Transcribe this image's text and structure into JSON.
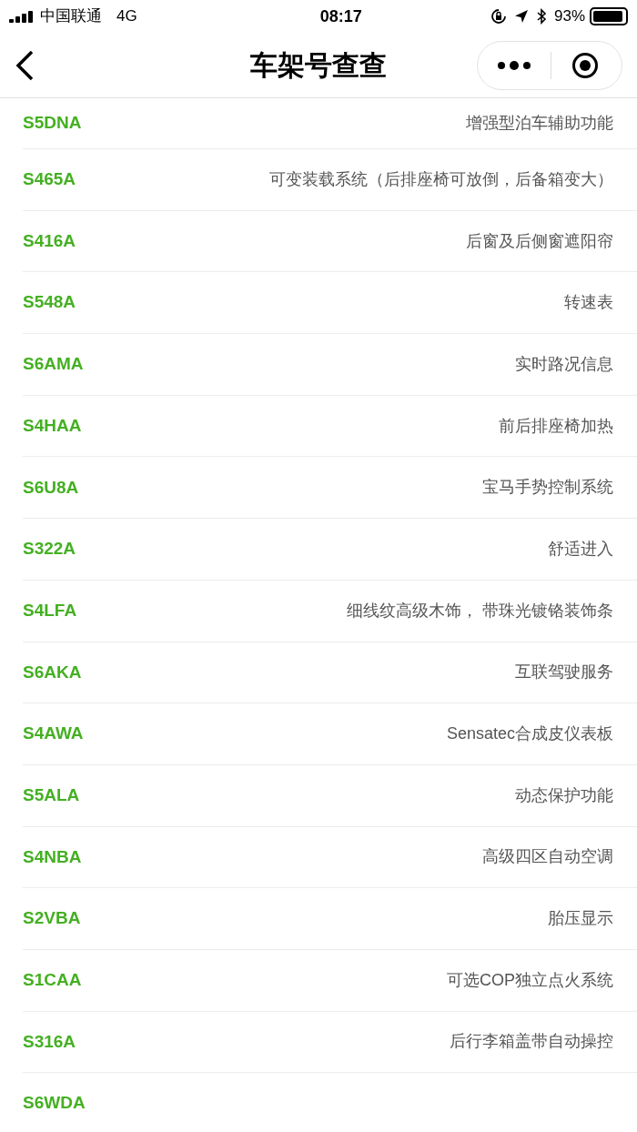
{
  "status_bar": {
    "carrier": "中国联通",
    "network": "4G",
    "time": "08:17",
    "battery": "93%"
  },
  "nav": {
    "title": "车架号查查"
  },
  "rows": [
    {
      "code": "S5DNA",
      "description": "增强型泊车辅助功能"
    },
    {
      "code": "S465A",
      "description": "可变装载系统（后排座椅可放倒，后备箱变大）"
    },
    {
      "code": "S416A",
      "description": "后窗及后侧窗遮阳帘"
    },
    {
      "code": "S548A",
      "description": "转速表"
    },
    {
      "code": "S6AMA",
      "description": "实时路况信息"
    },
    {
      "code": "S4HAA",
      "description": "前后排座椅加热"
    },
    {
      "code": "S6U8A",
      "description": "宝马手势控制系统"
    },
    {
      "code": "S322A",
      "description": "舒适进入"
    },
    {
      "code": "S4LFA",
      "description": "细线纹高级木饰， 带珠光镀铬装饰条"
    },
    {
      "code": "S6AKA",
      "description": "互联驾驶服务"
    },
    {
      "code": "S4AWA",
      "description": "Sensatec合成皮仪表板"
    },
    {
      "code": "S5ALA",
      "description": "动态保护功能"
    },
    {
      "code": "S4NBA",
      "description": "高级四区自动空调"
    },
    {
      "code": "S2VBA",
      "description": "胎压显示"
    },
    {
      "code": "S1CAA",
      "description": "可选COP独立点火系统"
    },
    {
      "code": "S316A",
      "description": "后行李箱盖带自动操控"
    },
    {
      "code": "S6WDA"
    }
  ]
}
